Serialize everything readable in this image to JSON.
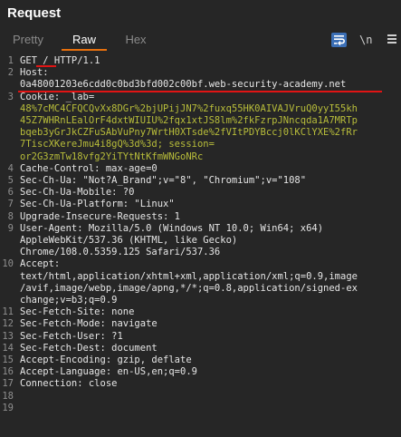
{
  "panel": {
    "title": "Request"
  },
  "tabs": [
    {
      "label": "Pretty",
      "active": false
    },
    {
      "label": "Raw",
      "active": true
    },
    {
      "label": "Hex",
      "active": false
    }
  ],
  "toolbar": {
    "wrap_icon": "word-wrap-icon",
    "newline_label": "\\n",
    "menu_icon": "hamburger-menu-icon"
  },
  "colors": {
    "accent": "#e8700d",
    "active_tool": "#3b6fb6",
    "cookie_value": "#b8bd3a",
    "annotation": "#e01414"
  },
  "editor": {
    "lines": [
      {
        "n": "1",
        "text": "GET / HTTP/1.1"
      },
      {
        "n": "2",
        "text": "Host:"
      },
      {
        "n": "",
        "text": "0a48001203e6cdd0c0bd3bfd002c00bf.web-security-academy.net"
      },
      {
        "n": "3",
        "text": "Cookie: _lab="
      },
      {
        "n": "",
        "text": "48%7cMC4CFQCQvXx8DGr%2bjUPijJN7%2fuxq55HK0AIVAJVruQ0yyI55kh",
        "cls": "cookie"
      },
      {
        "n": "",
        "text": "45Z7WHRnLEalOrF4dxtWIUIU%2fqx1xtJS8lm%2fkFzrpJNncqda1A7MRTp",
        "cls": "cookie"
      },
      {
        "n": "",
        "text": "bqeb3yGrJkCZFuSAbVuPny7WrtH0XTsde%2fVItPDYBccj0lKClYXE%2fRr",
        "cls": "cookie"
      },
      {
        "n": "",
        "text": "7TiscXKereJmu4i8gQ%3d%3d; session=",
        "cls": "cookie"
      },
      {
        "n": "",
        "text": "or2G3zmTw18vfg2YiTYtNtKfmWNGoNRc",
        "cls": "cookie"
      },
      {
        "n": "4",
        "text": "Cache-Control: max-age=0"
      },
      {
        "n": "5",
        "text": "Sec-Ch-Ua: \"Not?A_Brand\";v=\"8\", \"Chromium\";v=\"108\""
      },
      {
        "n": "6",
        "text": "Sec-Ch-Ua-Mobile: ?0"
      },
      {
        "n": "7",
        "text": "Sec-Ch-Ua-Platform: \"Linux\""
      },
      {
        "n": "8",
        "text": "Upgrade-Insecure-Requests: 1"
      },
      {
        "n": "9",
        "text": "User-Agent: Mozilla/5.0 (Windows NT 10.0; Win64; x64)"
      },
      {
        "n": "",
        "text": "AppleWebKit/537.36 (KHTML, like Gecko)"
      },
      {
        "n": "",
        "text": "Chrome/108.0.5359.125 Safari/537.36"
      },
      {
        "n": "10",
        "text": "Accept:"
      },
      {
        "n": "",
        "text": "text/html,application/xhtml+xml,application/xml;q=0.9,image"
      },
      {
        "n": "",
        "text": "/avif,image/webp,image/apng,*/*;q=0.8,application/signed-ex"
      },
      {
        "n": "",
        "text": "change;v=b3;q=0.9"
      },
      {
        "n": "11",
        "text": "Sec-Fetch-Site: none"
      },
      {
        "n": "12",
        "text": "Sec-Fetch-Mode: navigate"
      },
      {
        "n": "13",
        "text": "Sec-Fetch-User: ?1"
      },
      {
        "n": "14",
        "text": "Sec-Fetch-Dest: document"
      },
      {
        "n": "15",
        "text": "Accept-Encoding: gzip, deflate"
      },
      {
        "n": "16",
        "text": "Accept-Language: en-US,en;q=0.9"
      },
      {
        "n": "17",
        "text": "Connection: close"
      },
      {
        "n": "18",
        "text": ""
      },
      {
        "n": "19",
        "text": ""
      }
    ]
  }
}
